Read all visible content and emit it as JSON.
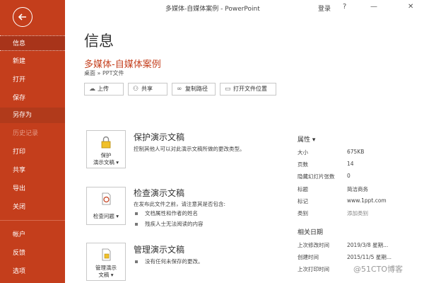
{
  "window": {
    "title": "多媒体-自媒体案例 - PowerPoint",
    "login": "登录",
    "help": "?",
    "minimize": "—",
    "close": "✕"
  },
  "sidebar": {
    "items": [
      {
        "label": "信息"
      },
      {
        "label": "新建"
      },
      {
        "label": "打开"
      },
      {
        "label": "保存"
      },
      {
        "label": "另存为"
      },
      {
        "label": "历史记录"
      },
      {
        "label": "打印"
      },
      {
        "label": "共享"
      },
      {
        "label": "导出"
      },
      {
        "label": "关闭"
      },
      {
        "label": "帐户"
      },
      {
        "label": "反馈"
      },
      {
        "label": "选项"
      }
    ]
  },
  "main": {
    "page_title": "信息",
    "doc_title": "多媒体-自媒体案例",
    "path": "桌面 » PPT文件",
    "actions": {
      "upload": "上传",
      "share": "共享",
      "copy_path": "复制路径",
      "open_location": "打开文件位置"
    },
    "protect": {
      "button_line1": "保护",
      "button_line2": "演示文稿 ▾",
      "title": "保护演示文稿",
      "desc": "控制其他人可以对此演示文稿所做的更改类型。"
    },
    "inspect": {
      "button_label": "检查问题 ▾",
      "title": "检查演示文稿",
      "desc": "在发布此文件之前，请注意其是否包含:",
      "bullets": [
        "文档属性和作者的姓名",
        "残疾人士无法阅读的内容"
      ]
    },
    "manage": {
      "button_line1": "管理演示",
      "button_line2": "文稿 ▾",
      "title": "管理演示文稿",
      "bullet": "没有任何未保存的更改。"
    }
  },
  "properties": {
    "heading": "属性 ▾",
    "rows": [
      {
        "label": "大小",
        "value": "675KB"
      },
      {
        "label": "页数",
        "value": "14"
      },
      {
        "label": "隐藏幻灯片张数",
        "value": "0"
      },
      {
        "label": "标题",
        "value": "简洁商务"
      },
      {
        "label": "标记",
        "value": "www.1ppt.com"
      },
      {
        "label": "类别",
        "value": "添加类别"
      }
    ],
    "dates_heading": "相关日期",
    "dates": [
      {
        "label": "上次修改时间",
        "value": "2019/3/8 星期..."
      },
      {
        "label": "创建时间",
        "value": "2015/11/5 星期..."
      },
      {
        "label": "上次打印时间",
        "value": ""
      }
    ]
  },
  "watermark": "@51CTO博客",
  "colors": {
    "accent": "#c43e1c"
  }
}
